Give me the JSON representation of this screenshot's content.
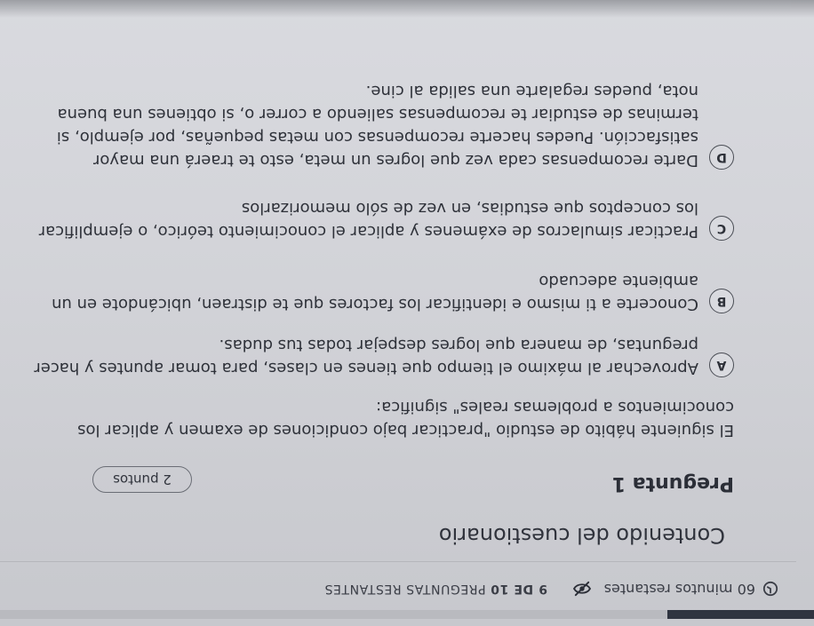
{
  "status": {
    "timer_text": "60 minutos restantes",
    "counter_bold": "9 DE 10",
    "counter_rest": " PREGUNTAS RESTANTES",
    "progress_fraction": 0.18
  },
  "quiz": {
    "title": "Contenido del cuestionario"
  },
  "question": {
    "title": "Pregunta 1",
    "points": "2 puntos",
    "prompt": "El siguiente hábito de estudio \"practicar bajo condiciones de examen y aplicar los conocimientos a problemas reales\" significa:",
    "options": [
      {
        "letter": "A",
        "text": "Aprovechar al máximo el tiempo que tienes en clases, para tomar apuntes y hacer preguntas, de manera que logres despejar todas tus dudas."
      },
      {
        "letter": "B",
        "text": "Conocerte a ti mismo e identificar los factores que te distraen, ubicándote en un ambiente adecuado"
      },
      {
        "letter": "C",
        "text": "Practicar simulacros de exámenes y aplicar el conocimiento teórico, o ejemplificar los conceptos que estudias, en vez de sólo memorizarlos"
      },
      {
        "letter": "D",
        "text": "Darte recompensas cada vez que logres un meta, esto te traerá una mayor satisfacción. Puedes hacerte recompensas con metas pequeñas, por ejemplo, si terminas de estudiar te recompensas saliendo a correr o, si obtienes una buena nota, puedes regalarte una salida al cine."
      }
    ]
  },
  "icons": {
    "timer": "clock-icon",
    "hide": "eye-slash-icon"
  }
}
